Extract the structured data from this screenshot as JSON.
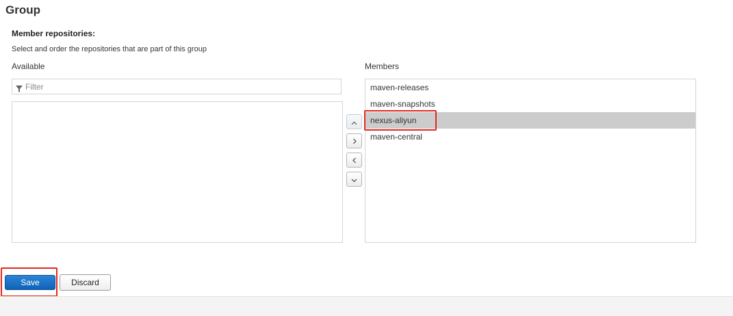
{
  "header": {
    "title": "Group"
  },
  "section": {
    "label": "Member repositories:",
    "description": "Select and order the repositories that are part of this group"
  },
  "available": {
    "label": "Available",
    "filter_placeholder": "Filter",
    "items": []
  },
  "members": {
    "label": "Members",
    "items": [
      {
        "label": "maven-releases",
        "selected": false
      },
      {
        "label": "maven-snapshots",
        "selected": false
      },
      {
        "label": "nexus-aliyun",
        "selected": true
      },
      {
        "label": "maven-central",
        "selected": false
      }
    ]
  },
  "move_buttons": [
    {
      "name": "move-up-button",
      "icon": "chevron-up-icon"
    },
    {
      "name": "move-right-button",
      "icon": "chevron-right-icon"
    },
    {
      "name": "move-left-button",
      "icon": "chevron-left-icon"
    },
    {
      "name": "move-down-button",
      "icon": "chevron-down-icon"
    }
  ],
  "actions": {
    "save_label": "Save",
    "discard_label": "Discard"
  },
  "colors": {
    "highlight": "#e5261d",
    "selected_row": "#cccccc",
    "primary_button": "#1a6fc4"
  }
}
